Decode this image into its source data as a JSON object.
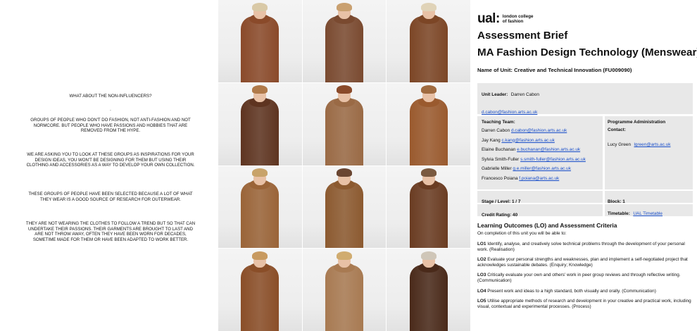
{
  "left_text": {
    "heading": "WHAT ABOUT THE NON-INFLUENCERS?",
    "dot": ".",
    "p1": "GROUPS OF PEOPLE WHO DON'T DO FASHION, NOT ANTI-FASHION AND NOT NORMCORE. BUT PEOPLE WHO HAVE PASSIONS AND HOBBIES THAT ARE REMOVED FROM THE HYPE.",
    "p2": "WE ARE ASKING YOU TO LOOK AT THESE GROUPS AS INSPIRATIONS FOR YOUR DESIGN IDEAS, YOU WON'T BE DESIGNING FOR THEM BUT USING THEIR CLOTHING AND ACCESSORIES AS A WAY TO DEVELOP YOUR OWN COLLECTION.",
    "p3": "THESE GROUPS OF PEOPLE HAVE BEEN SELECTED BECAUSE A LOT OF WHAT THEY WEAR IS A GOOD SOURCE OF RESEARCH FOR OUTERWEAR.",
    "p4": "THEY ARE NOT WEARING THE CLOTHES TO FOLLOW A TREND BUT SO THAT CAN UNDERTAKE THEIR PASSIONS. THEIR GARMENTS ARE BROUGHT TO LAST AND ARE NOT THROW AWAY, OFTEN THEY HAVE BEEN WORN FOR DECADES, SOMETIME MADE FOR THEM OR HAVE BEEN ADAPTED TO WORK BETTER."
  },
  "photos": [
    {
      "coat": "#8a4a2a",
      "hair": "#d9c9a6"
    },
    {
      "coat": "#7a4a30",
      "hair": "#c9a070"
    },
    {
      "coat": "#7c4626",
      "hair": "#e0d3b8"
    },
    {
      "coat": "#5e3420",
      "hair": "#b07a4a"
    },
    {
      "coat": "#9a6a45",
      "hair": "#8a4a2a"
    },
    {
      "coat": "#9a5a2e",
      "hair": "#a06b40"
    },
    {
      "coat": "#9a6438",
      "hair": "#c8a36a"
    },
    {
      "coat": "#8c5a30",
      "hair": "#6a4632"
    },
    {
      "coat": "#6a3c22",
      "hair": "#7a5a40"
    },
    {
      "coat": "#8a4e28",
      "hair": "#c89a60"
    },
    {
      "coat": "#a87a52",
      "hair": "#d0ac70"
    },
    {
      "coat": "#4a2a1a",
      "hair": "#cfc6b8"
    }
  ],
  "doc": {
    "logo_mark": "ual:",
    "logo_line1": "london college",
    "logo_line2": "of fashion",
    "title1": "Assessment Brief",
    "title2": "MA Fashion Design Technology (Menswear)",
    "unit_name": "Name of Unit: Creative and Technical Innovation (FU009090)",
    "unit_leader_label": "Unit Leader:",
    "unit_leader_name": "Darren Cabon",
    "unit_leader_email": "d.cabon@fashion.arts.ac.uk",
    "teaching_label": "Teaching Team:",
    "team": [
      {
        "name": "Darren Cabon",
        "email": "d.cabon@fashion.arts.ac.uk"
      },
      {
        "name": "Jay Kang",
        "email": "c.kang@fashion.arts.ac.uk"
      },
      {
        "name": "Elaine Buchanan",
        "email": "e.buchanan@fashion.arts.ac.uk"
      },
      {
        "name": "Sylvia Smith-Fuller",
        "email": "s.smith-fuller@fashion.arts.ac.uk"
      },
      {
        "name": "Gabrielle Miller",
        "email": "g.e.miller@fashion.arts.ac.uk"
      },
      {
        "name": "Francesco Poiana",
        "email": "f.poiana@arts.ac.uk"
      }
    ],
    "admin_label_1": "Programme Administration",
    "admin_label_2": "Contact:",
    "admin_name": "Lucy Green",
    "admin_email": "lgreen@arts.ac.uk",
    "stage_label": "Stage / Level: 1 / 7",
    "block_label": "Block: 1",
    "credit_label": "Credit Rating: 40",
    "timetable_label": "Timetable:",
    "timetable_link": "UAL Timetable",
    "lo_heading": "Learning Outcomes (LO) and Assessment Criteria",
    "lo_intro": "On completion of this unit you will be able to:",
    "los": [
      {
        "code": "LO1",
        "text": " Identify, analyse, and creatively solve technical problems through the development of your personal work. (Realisation)"
      },
      {
        "code": "LO2",
        "text": " Evaluate your personal strengths and weaknesses, plan and implement a self-negotiated project that acknowledges sustainable debates. (Enquiry; Knowledge)"
      },
      {
        "code": "LO3",
        "text": " Critically evaluate your own and others' work in peer group reviews and through reflective writing. (Communication)"
      },
      {
        "code": "LO4",
        "text": " Present work and ideas to a high standard, both visually and orally. (Communication)"
      },
      {
        "code": "LO5",
        "text": " Utilise appropriate methods of research and development in your creative and practical work, including visual, contextual and experimental processes. (Process)"
      }
    ]
  }
}
